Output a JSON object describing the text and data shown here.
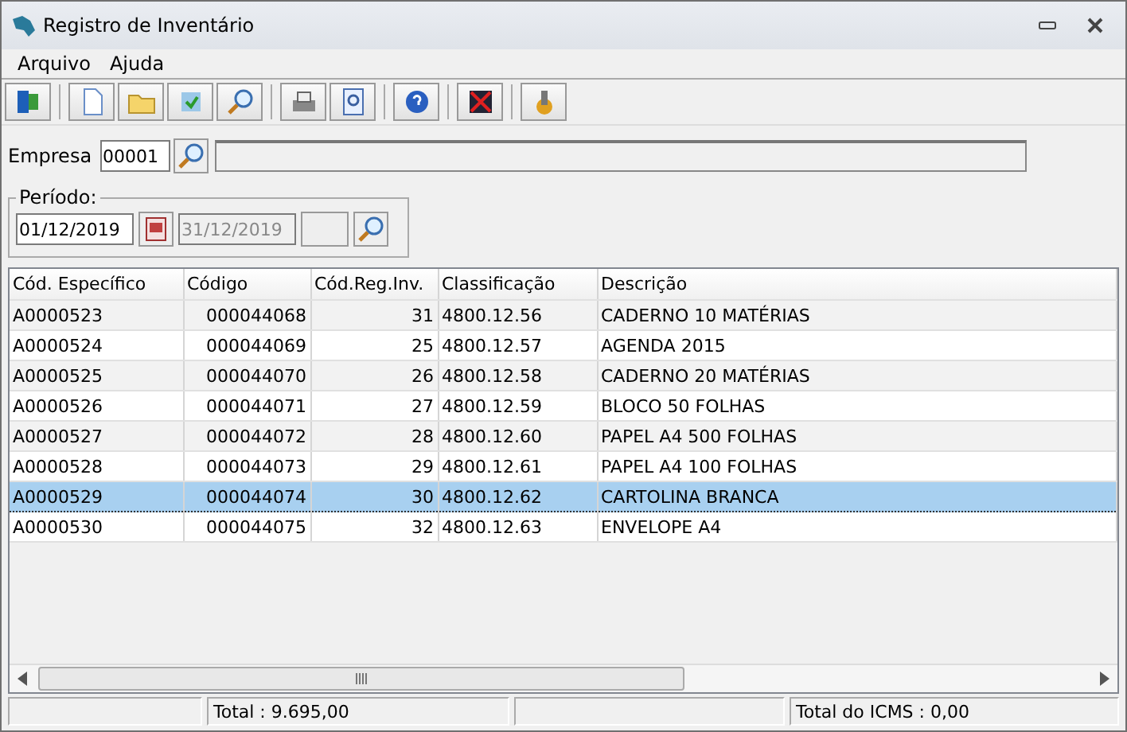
{
  "window": {
    "title": "Registro de Inventário"
  },
  "menu": [
    "Arquivo",
    "Ajuda"
  ],
  "empresa": {
    "label": "Empresa",
    "value": "00001"
  },
  "periodo": {
    "label": "Período:",
    "start": "01/12/2019",
    "end": "31/12/2019"
  },
  "table": {
    "columns": [
      "Cód. Específico",
      "Código",
      "Cód.Reg.Inv.",
      "Classificação",
      "Descrição"
    ],
    "rows": [
      {
        "cells": [
          "A0000523",
          "000044068",
          "31",
          "4800.12.56",
          "CADERNO 10 MATÉRIAS"
        ],
        "selected": false
      },
      {
        "cells": [
          "A0000524",
          "000044069",
          "25",
          "4800.12.57",
          "AGENDA 2015"
        ],
        "selected": false
      },
      {
        "cells": [
          "A0000525",
          "000044070",
          "26",
          "4800.12.58",
          "CADERNO 20 MATÉRIAS"
        ],
        "selected": false
      },
      {
        "cells": [
          "A0000526",
          "000044071",
          "27",
          "4800.12.59",
          "BLOCO 50 FOLHAS"
        ],
        "selected": false
      },
      {
        "cells": [
          "A0000527",
          "000044072",
          "28",
          "4800.12.60",
          "PAPEL A4 500 FOLHAS"
        ],
        "selected": false
      },
      {
        "cells": [
          "A0000528",
          "000044073",
          "29",
          "4800.12.61",
          "PAPEL A4 100 FOLHAS"
        ],
        "selected": false
      },
      {
        "cells": [
          "A0000529",
          "000044074",
          "30",
          "4800.12.62",
          "CARTOLINA BRANCA"
        ],
        "selected": true
      },
      {
        "cells": [
          "A0000530",
          "000044075",
          "32",
          "4800.12.63",
          "ENVELOPE A4"
        ],
        "selected": false
      }
    ]
  },
  "status_bar": [
    "Total : 9.695,00",
    "Total do ICMS : 0,00"
  ]
}
